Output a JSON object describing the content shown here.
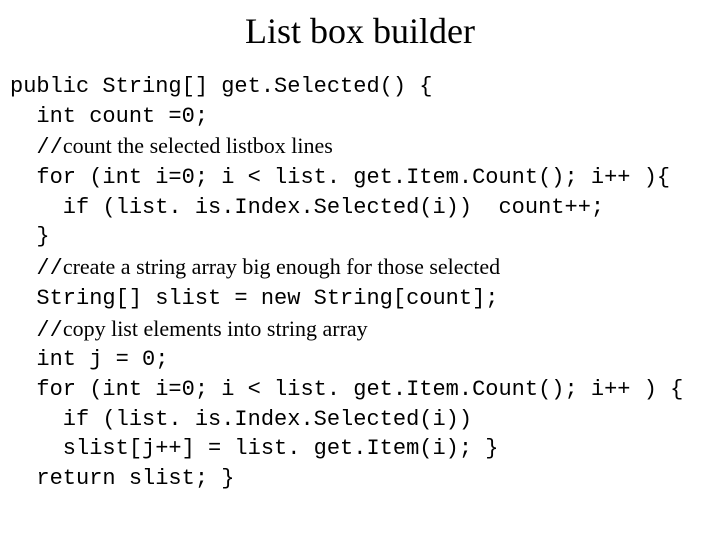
{
  "title": "List box builder",
  "lines": {
    "l1": "public String[] get.Selected() {",
    "l2": "  int count =0;",
    "l3a": "  //",
    "l3b": "count the selected listbox lines",
    "l4": "  for (int i=0; i < list. get.Item.Count(); i++ ){",
    "l5": "    if (list. is.Index.Selected(i))  count++;",
    "l6": "  }",
    "l7a": "  //",
    "l7b": "create a string array big enough for those selected",
    "l8": "  String[] slist = new String[count];",
    "l9a": "  //",
    "l9b": "copy list elements into string array",
    "l10": "  int j = 0;",
    "l11": "  for (int i=0; i < list. get.Item.Count(); i++ ) {",
    "l12": "    if (list. is.Index.Selected(i))",
    "l13": "    slist[j++] = list. get.Item(i); }",
    "l14": "  return slist; }"
  }
}
